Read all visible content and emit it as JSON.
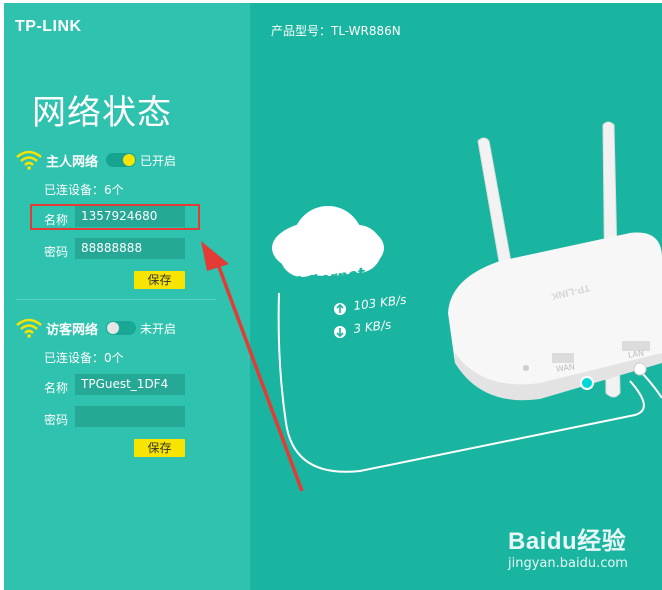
{
  "brand": "TP-LINK",
  "model_label": "产品型号：TL-WR886N",
  "page_title": "网络状态",
  "host_network": {
    "name": "主人网络",
    "toggle_state": "已开启",
    "connected_devices": "已连设备：6个",
    "ssid_label": "名称",
    "ssid_value": "1357924680",
    "password_label": "密码",
    "password_value": "88888888",
    "save_label": "保存"
  },
  "guest_network": {
    "name": "访客网络",
    "toggle_state": "未开启",
    "connected_devices": "已连设备：0个",
    "ssid_label": "名称",
    "ssid_value": "TPGuest_1DF4",
    "password_label": "密码",
    "password_value": "",
    "save_label": "保存"
  },
  "illustration": {
    "cloud_label": "Internet",
    "upload_speed": "103 KB/s",
    "download_speed": "3 KB/s",
    "port_wan": "WAN",
    "port_lan": "LAN",
    "router_brand": "TP-LINK"
  },
  "watermark": {
    "main": "Baidu经验",
    "sub": "jingyan.baidu.com"
  },
  "colors": {
    "sidebar": "#2fc2ae",
    "main": "#1ab5a0",
    "accent_button": "#f7e400",
    "wifi_icon": "#f7e400",
    "highlight_box": "#e33b35",
    "arrow": "#e33b35"
  }
}
